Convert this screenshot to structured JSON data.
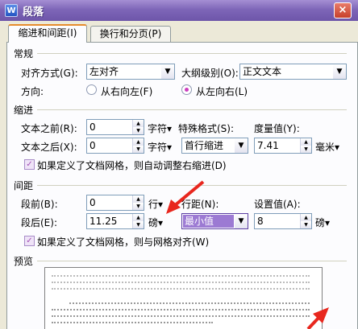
{
  "window": {
    "title": "段落",
    "icon": "wps-writer-icon",
    "close_symbol": "×"
  },
  "tabs": [
    {
      "label": "缩进和间距(I)",
      "active": true
    },
    {
      "label": "换行和分页(P)",
      "active": false
    }
  ],
  "general": {
    "section_label": "常规",
    "alignment_label": "对齐方式(G):",
    "alignment_value": "左对齐",
    "outline_label": "大纲级别(O):",
    "outline_value": "正文文本",
    "direction_label": "方向:",
    "rtl_label": "从右向左(F)",
    "ltr_label": "从左向右(L)",
    "direction_selected": "ltr"
  },
  "indent": {
    "section_label": "缩进",
    "before_label": "文本之前(R):",
    "before_value": "0",
    "before_unit": "字符▾",
    "after_label": "文本之后(X):",
    "after_value": "0",
    "after_unit": "字符▾",
    "special_label": "特殊格式(S):",
    "special_value": "首行缩进",
    "measure_label": "度量值(Y):",
    "measure_value": "7.41",
    "measure_unit": "毫米▾",
    "grid_checkbox_label": "如果定义了文档网格，则自动调整右缩进(D)",
    "grid_checked": true
  },
  "spacing": {
    "section_label": "间距",
    "before_label": "段前(B):",
    "before_value": "0",
    "before_unit": "行▾",
    "after_label": "段后(E):",
    "after_value": "11.25",
    "after_unit": "磅▾",
    "line_spacing_label": "行距(N):",
    "line_spacing_value": "最小值",
    "set_value_label": "设置值(A):",
    "set_value": "8",
    "set_value_unit": "磅▾",
    "grid_checkbox_label": "如果定义了文档网格，则与网格对齐(W)",
    "grid_checked": true
  },
  "preview": {
    "section_label": "预览"
  },
  "colors": {
    "accent": "#9c7ad3",
    "arrow": "#e8271e",
    "title_bar": "#7e66b8"
  }
}
